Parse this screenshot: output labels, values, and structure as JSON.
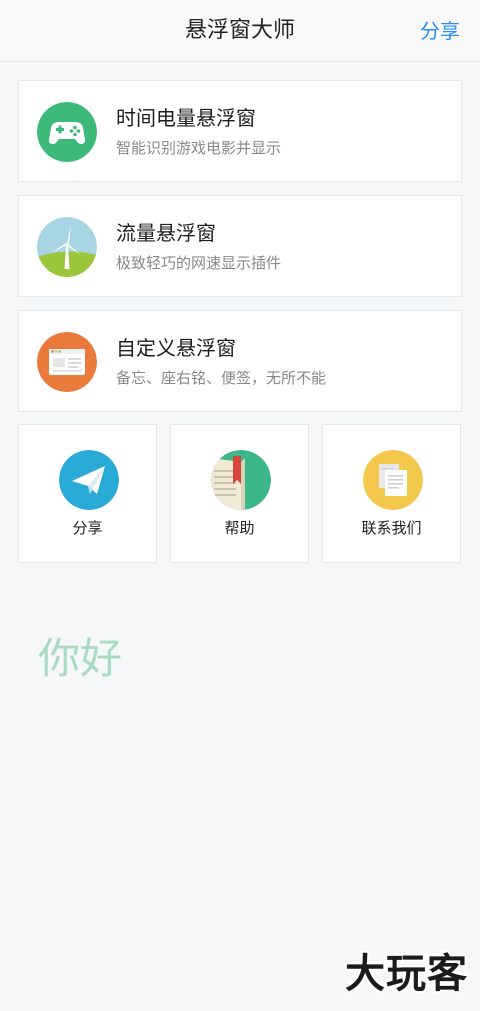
{
  "header": {
    "title": "悬浮窗大师",
    "share_label": "分享"
  },
  "features": [
    {
      "title": "时间电量悬浮窗",
      "subtitle": "智能识别游戏电影并显示",
      "icon": "gamepad-icon",
      "icon_color": "#3db97a"
    },
    {
      "title": "流量悬浮窗",
      "subtitle": "极致轻巧的网速显示插件",
      "icon": "windmill-icon",
      "icon_color": "#a7d5e4"
    },
    {
      "title": "自定义悬浮窗",
      "subtitle": "备忘、座右铭、便签，无所不能",
      "icon": "browser-window-icon",
      "icon_color": "#e97a3c"
    }
  ],
  "tiles": [
    {
      "label": "分享",
      "icon": "paper-plane-icon",
      "icon_color": "#2aaad6"
    },
    {
      "label": "帮助",
      "icon": "book-icon",
      "icon_color": "#3cb78a"
    },
    {
      "label": "联系我们",
      "icon": "documents-icon",
      "icon_color": "#f2c94c"
    }
  ],
  "hello_text": "你好",
  "watermark": "大玩客"
}
